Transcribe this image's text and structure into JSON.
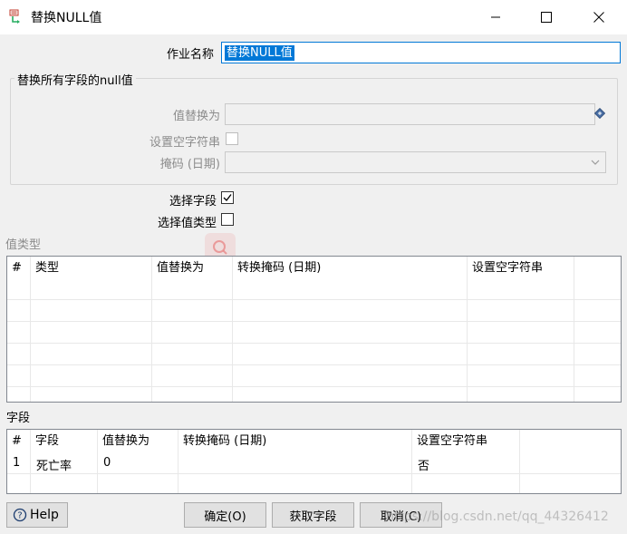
{
  "window": {
    "title": "替换NULL值"
  },
  "job_name": {
    "label": "作业名称",
    "value": "替换NULL值"
  },
  "all_fields_group": {
    "title": "替换所有字段的null值",
    "replace_with_label": "值替换为",
    "replace_with_value": "",
    "set_empty_label": "设置空字符串",
    "mask_label": "掩码 (日期)",
    "mask_value": ""
  },
  "select_fields": {
    "label": "选择字段",
    "checked": true
  },
  "select_value_types": {
    "label": "选择值类型",
    "checked": false
  },
  "value_types_section": {
    "title": "值类型",
    "columns": [
      "#",
      "类型",
      "值替换为",
      "转换掩码 (日期)",
      "设置空字符串"
    ]
  },
  "fields_section": {
    "title": "字段",
    "columns": [
      "#",
      "字段",
      "值替换为",
      "转换掩码 (日期)",
      "设置空字符串"
    ],
    "rows": [
      {
        "num": "1",
        "field": "死亡率",
        "replace": "0",
        "mask": "",
        "set_empty": "否"
      }
    ]
  },
  "buttons": {
    "help": "Help",
    "ok": "确定(O)",
    "get_fields": "获取字段",
    "cancel": "取消(C)"
  },
  "watermark": "https://blog.csdn.net/qq_44326412",
  "colors": {
    "accent": "#0078d7",
    "disabled_text": "#8c8c8c"
  }
}
